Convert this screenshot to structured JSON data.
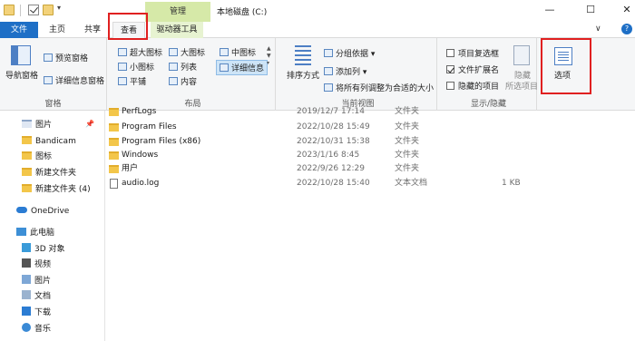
{
  "titlebar": {
    "manage_tab": "管理",
    "window_title": "本地磁盘 (C:)",
    "minimize": "—",
    "maximize": "☐",
    "close": "✕"
  },
  "tabs": {
    "file": "文件",
    "home": "主页",
    "share": "共享",
    "view": "查看",
    "drive_tools": "驱动器工具",
    "chevron": "∨",
    "help": "?"
  },
  "ribbon": {
    "pane_group": {
      "label": "窗格",
      "nav_pane": "导航窗格",
      "preview_pane": "预览窗格",
      "details_pane": "详细信息窗格"
    },
    "layout_group": {
      "label": "布局",
      "extra_large": "超大图标",
      "large": "大图标",
      "medium": "中图标",
      "small": "小图标",
      "list": "列表",
      "details": "详细信息",
      "tiles": "平铺",
      "content": "内容"
    },
    "current_view_group": {
      "label": "当前视图",
      "sort_by": "排序方式",
      "group_by": "分组依据",
      "add_columns": "添加列",
      "fit_columns": "将所有列调整为合适的大小"
    },
    "show_hide_group": {
      "label": "显示/隐藏",
      "item_checkboxes": "项目复选框",
      "item_checkboxes_checked": false,
      "file_extensions": "文件扩展名",
      "file_extensions_checked": true,
      "hidden_items": "隐藏的项目",
      "hidden_items_checked": false,
      "hide_selected": "隐藏",
      "hide_selected_2": "所选项目"
    },
    "options_group": {
      "options": "选项"
    }
  },
  "navtree": {
    "items": [
      {
        "label": "图片",
        "icon": "pictures-icon"
      },
      {
        "label": "Bandicam",
        "icon": "folder-icon"
      },
      {
        "label": "图标",
        "icon": "folder-icon"
      },
      {
        "label": "新建文件夹",
        "icon": "folder-icon"
      },
      {
        "label": "新建文件夹 (4)",
        "icon": "folder-icon"
      },
      {
        "label": "OneDrive",
        "icon": "cloud-icon"
      },
      {
        "label": "此电脑",
        "icon": "computer-icon"
      },
      {
        "label": "3D 对象",
        "icon": "3d-objects-icon"
      },
      {
        "label": "视频",
        "icon": "videos-icon"
      },
      {
        "label": "图片",
        "icon": "pictures-icon"
      },
      {
        "label": "文档",
        "icon": "documents-icon"
      },
      {
        "label": "下载",
        "icon": "downloads-icon"
      },
      {
        "label": "音乐",
        "icon": "music-icon"
      }
    ],
    "pin": "📌"
  },
  "files": [
    {
      "name": "PerfLogs",
      "date": "2019/12/7 17:14",
      "type": "文件夹",
      "size": ""
    },
    {
      "name": "Program Files",
      "date": "2022/10/28 15:49",
      "type": "文件夹",
      "size": ""
    },
    {
      "name": "Program Files (x86)",
      "date": "2022/10/31 15:38",
      "type": "文件夹",
      "size": ""
    },
    {
      "name": "Windows",
      "date": "2023/1/16 8:45",
      "type": "文件夹",
      "size": ""
    },
    {
      "name": "用户",
      "date": "2022/9/26 12:29",
      "type": "文件夹",
      "size": ""
    },
    {
      "name": "audio.log",
      "date": "2022/10/28 15:40",
      "type": "文本文档",
      "size": "1 KB"
    }
  ]
}
